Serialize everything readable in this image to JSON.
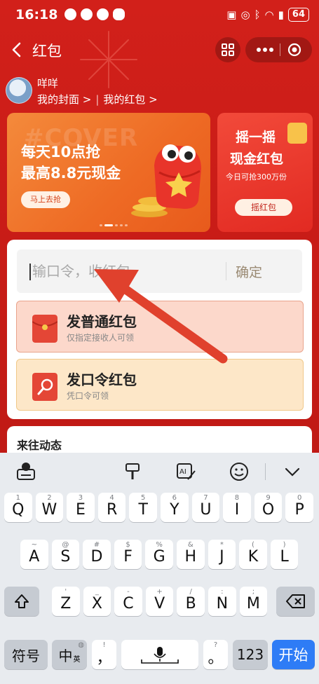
{
  "status_bar": {
    "time": "16:18",
    "battery": "64"
  },
  "header": {
    "title": "红包"
  },
  "profile": {
    "name": "咩咩",
    "my_cover": "我的封面 >",
    "my_redpacket": "我的红包 >"
  },
  "banner_left": {
    "bg_text": "#COVER",
    "line1": "每天10点抢",
    "line2": "最高8.8元现金",
    "button": "马上去抢"
  },
  "banner_right": {
    "line1": "摇一摇",
    "line2": "现金红包",
    "line3": "今日可抢300万份",
    "button": "摇红包"
  },
  "command_input": {
    "placeholder": "输口令，收红包",
    "confirm": "确定"
  },
  "options": [
    {
      "title": "发普通红包",
      "subtitle": "仅指定接收人可领"
    },
    {
      "title": "发口令红包",
      "subtitle": "凭口令可领"
    }
  ],
  "recent": {
    "label": "来往动态"
  },
  "keyboard": {
    "row1": [
      {
        "k": "Q",
        "h": "1"
      },
      {
        "k": "W",
        "h": "2"
      },
      {
        "k": "E",
        "h": "3"
      },
      {
        "k": "R",
        "h": "4"
      },
      {
        "k": "T",
        "h": "5"
      },
      {
        "k": "Y",
        "h": "6"
      },
      {
        "k": "U",
        "h": "7"
      },
      {
        "k": "I",
        "h": "8"
      },
      {
        "k": "O",
        "h": "9"
      },
      {
        "k": "P",
        "h": "0"
      }
    ],
    "row2": [
      {
        "k": "A",
        "h": "~"
      },
      {
        "k": "S",
        "h": "@"
      },
      {
        "k": "D",
        "h": "#"
      },
      {
        "k": "F",
        "h": "$"
      },
      {
        "k": "G",
        "h": "%"
      },
      {
        "k": "H",
        "h": "&"
      },
      {
        "k": "J",
        "h": "*"
      },
      {
        "k": "K",
        "h": "("
      },
      {
        "k": "L",
        "h": ")"
      }
    ],
    "row3": [
      {
        "k": "Z",
        "h": "'"
      },
      {
        "k": "X",
        "h": "_"
      },
      {
        "k": "C",
        "h": "-"
      },
      {
        "k": "V",
        "h": "+"
      },
      {
        "k": "B",
        "h": "/"
      },
      {
        "k": "N",
        "h": ":"
      },
      {
        "k": "M",
        "h": ";"
      }
    ],
    "symbols": "符号",
    "lang": "中",
    "lang_sub": "英",
    "comma": "，",
    "comma_hint": "!",
    "period": "。",
    "period_hint": "?",
    "numbers": "123",
    "start": "开始"
  },
  "colors": {
    "brand_red": "#d2201a",
    "accent_blue": "#2e7cf6",
    "arrow": "#e0412d"
  }
}
